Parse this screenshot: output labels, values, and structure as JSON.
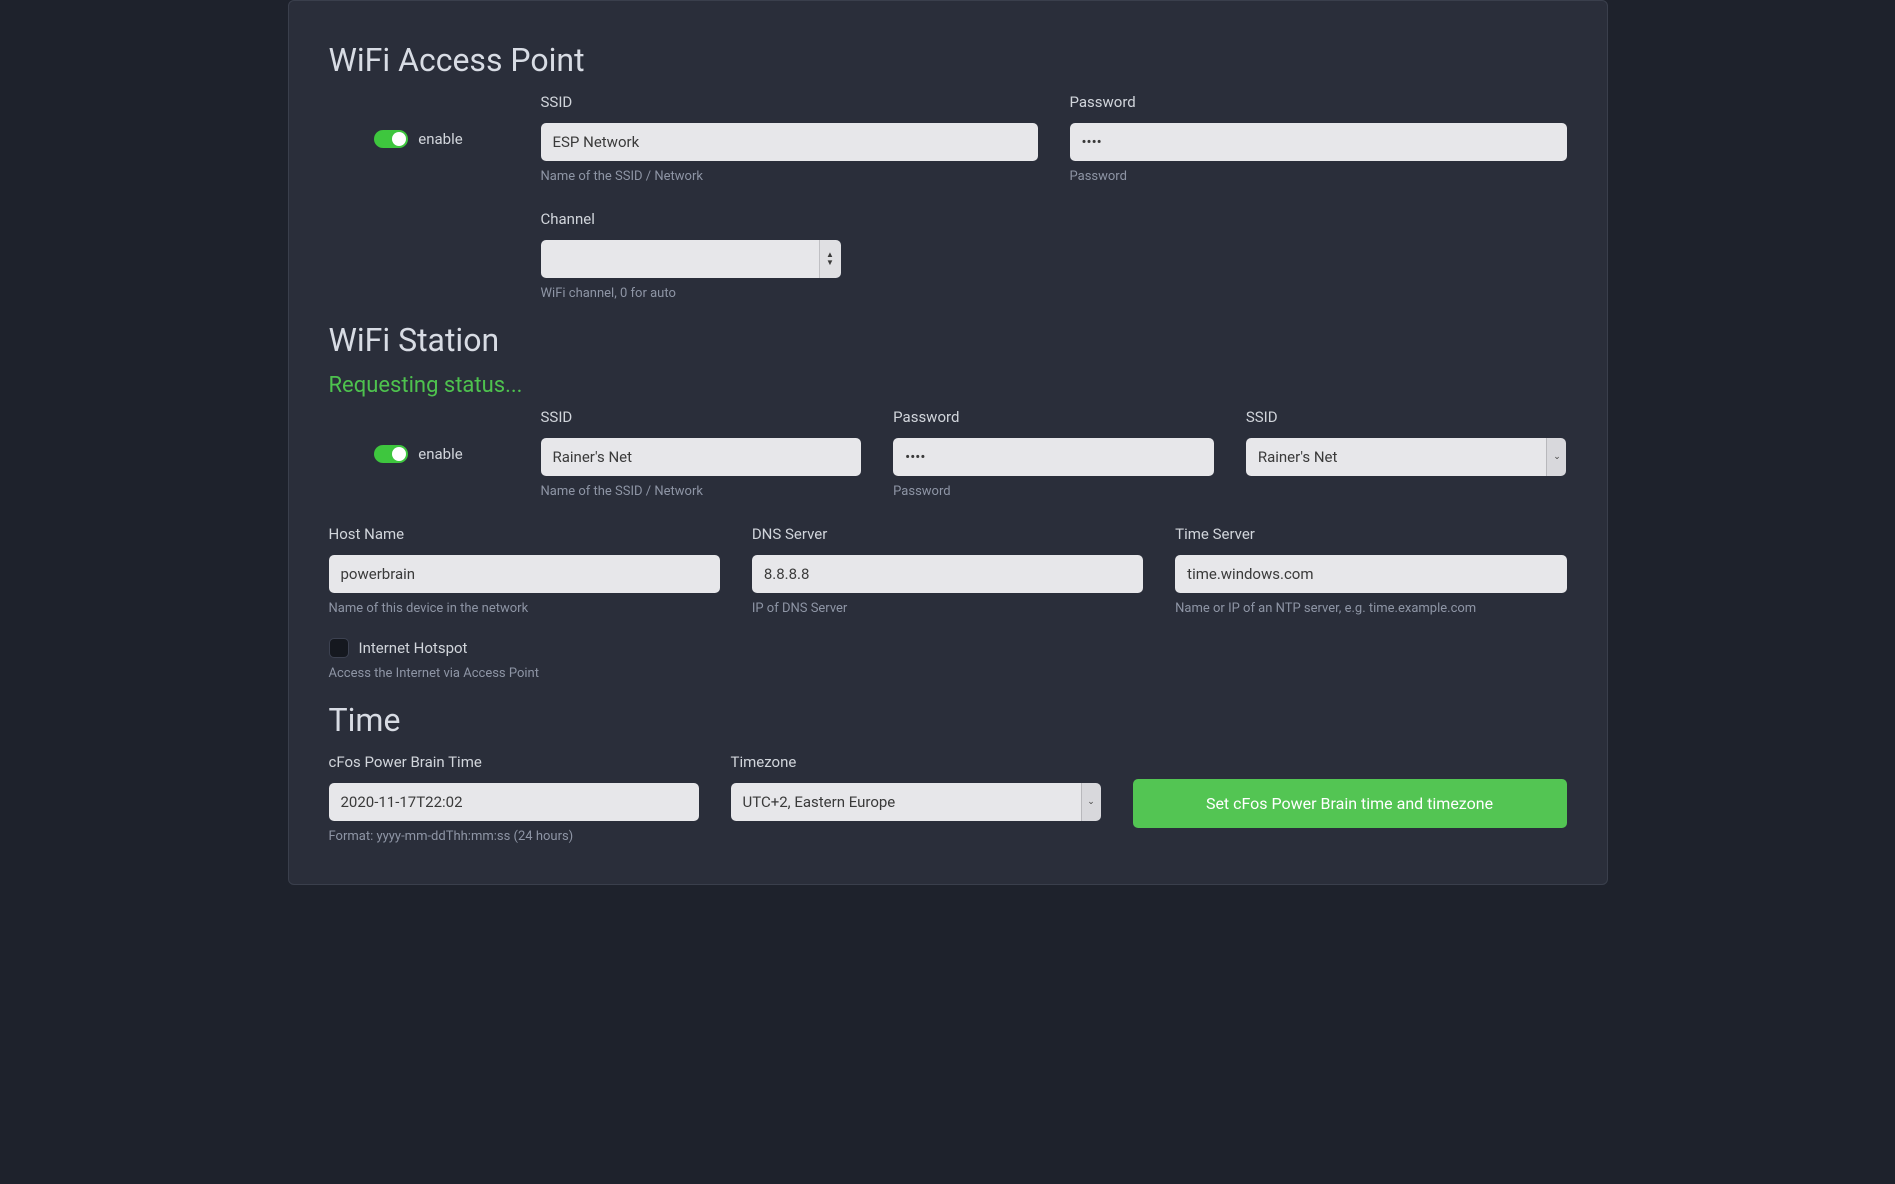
{
  "ap": {
    "title": "WiFi Access Point",
    "enable_label": "enable",
    "ssid": {
      "label": "SSID",
      "value": "ESP Network",
      "help": "Name of the SSID / Network"
    },
    "password": {
      "label": "Password",
      "value": "••••",
      "help": "Password"
    },
    "channel": {
      "label": "Channel",
      "value": "",
      "help": "WiFi channel, 0 for auto"
    }
  },
  "sta": {
    "title": "WiFi Station",
    "status": "Requesting status...",
    "enable_label": "enable",
    "ssid": {
      "label": "SSID",
      "value": "Rainer's Net",
      "help": "Name of the SSID / Network"
    },
    "password": {
      "label": "Password",
      "value": "••••",
      "help": "Password"
    },
    "ssid_select": {
      "label": "SSID",
      "value": "Rainer's Net"
    },
    "host": {
      "label": "Host Name",
      "value": "powerbrain",
      "help": "Name of this device in the network"
    },
    "dns": {
      "label": "DNS Server",
      "value": "8.8.8.8",
      "help": "IP of DNS Server"
    },
    "timeserver": {
      "label": "Time Server",
      "value": "time.windows.com",
      "help": "Name or IP of an NTP server, e.g. time.example.com"
    },
    "hotspot": {
      "label": "Internet Hotspot",
      "help": "Access the Internet via Access Point"
    }
  },
  "time": {
    "title": "Time",
    "brain": {
      "label": "cFos Power Brain Time",
      "value": "2020-11-17T22:02",
      "help": "Format: yyyy-mm-ddThh:mm:ss (24 hours)"
    },
    "tz": {
      "label": "Timezone",
      "value": "UTC+2, Eastern Europe"
    },
    "button": "Set cFos Power Brain time and timezone"
  }
}
